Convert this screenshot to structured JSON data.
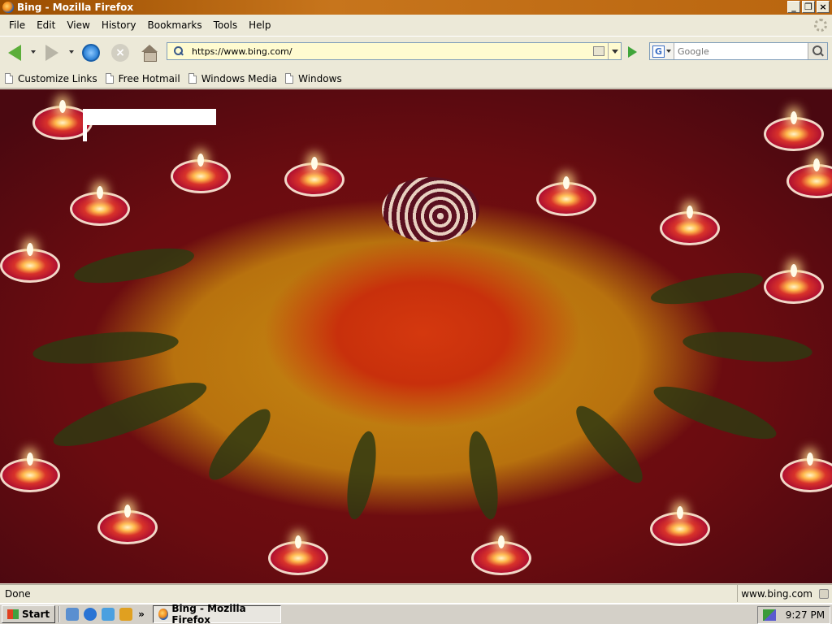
{
  "window": {
    "title": "Bing - Mozilla Firefox",
    "controls": {
      "minimize": "_",
      "maximize": "❐",
      "close": "×"
    }
  },
  "menu": [
    "File",
    "Edit",
    "View",
    "History",
    "Bookmarks",
    "Tools",
    "Help"
  ],
  "nav": {
    "url": "https://www.bing.com/",
    "search_placeholder": "Google",
    "search_engine_letter": "G"
  },
  "bookmarks": [
    "Customize Links",
    "Free Hotmail",
    "Windows Media",
    "Windows"
  ],
  "status": {
    "text": "Done",
    "url": "www.bing.com"
  },
  "taskbar": {
    "start_label": "Start",
    "more": "»",
    "task_label": "Bing - Mozilla Firefox",
    "clock": "9:27 PM"
  }
}
